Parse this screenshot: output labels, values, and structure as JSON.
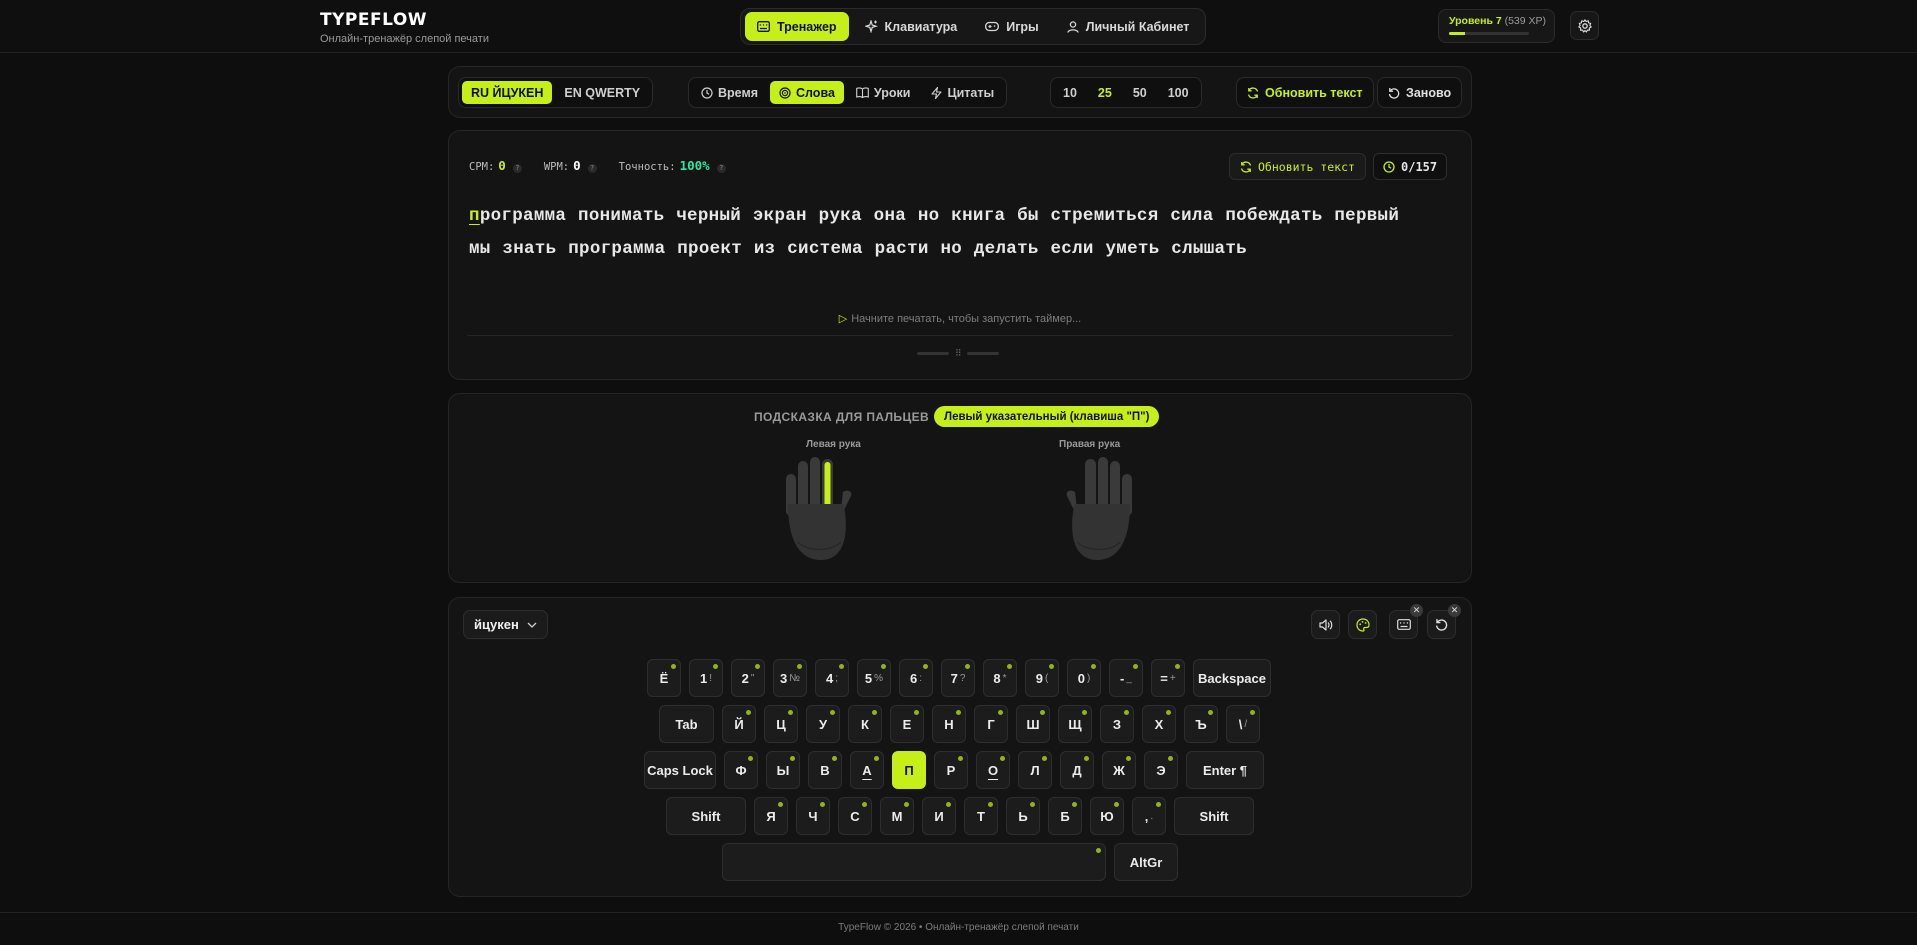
{
  "brand": {
    "title": "TYPEFLOW",
    "subtitle": "Онлайн-тренажёр слепой печати"
  },
  "nav": {
    "items": [
      {
        "label": "Тренажер",
        "icon": "keyboard-icon",
        "active": true
      },
      {
        "label": "Клавиатура",
        "icon": "sparkles-icon"
      },
      {
        "label": "Игры",
        "icon": "gamepad-icon"
      },
      {
        "label": "Личный Кабинет",
        "icon": "user-icon"
      }
    ]
  },
  "level": {
    "label": "Уровень 7",
    "xp": "(539 XP)",
    "progress": 0.2
  },
  "toolbar": {
    "layouts": [
      {
        "label": "RU ЙЦУКЕН",
        "active": true
      },
      {
        "label": "EN QWERTY"
      }
    ],
    "modes": [
      {
        "label": "Время",
        "icon": "clock-icon"
      },
      {
        "label": "Слова",
        "icon": "target-icon",
        "active": true
      },
      {
        "label": "Уроки",
        "icon": "book-icon"
      },
      {
        "label": "Цитаты",
        "icon": "quote-icon"
      }
    ],
    "counts": [
      {
        "label": "10"
      },
      {
        "label": "25",
        "active": true
      },
      {
        "label": "50"
      },
      {
        "label": "100"
      }
    ],
    "refresh_label": "Обновить текст",
    "restart_label": "Заново"
  },
  "typing": {
    "stats": [
      {
        "label": "CPM:",
        "value": "0",
        "color": "#c6ef1a"
      },
      {
        "label": "WPM:",
        "value": "0",
        "color": "#ffffff"
      },
      {
        "label": "Точность:",
        "value": "100%",
        "color": "#2ee6a0"
      }
    ],
    "help_mark": "?",
    "refresh_label": "Обновить текст",
    "counter": "0/157",
    "current_char": "п",
    "text_line1_rest": "рограмма понимать черный экран рука она но книга бы стремиться сила побеждать первый",
    "text_line2": "мы знать программа проект из система расти но делать если уметь слышать",
    "hint": "Начните печатать, чтобы запустить таймер..."
  },
  "fingers": {
    "title": "ПОДСКАЗКА ДЛЯ ПАЛЬЦЕВ",
    "badge": "Левый указательный (клавиша \"П\")",
    "left_label": "Левая рука",
    "right_label": "Правая рука"
  },
  "keyboard": {
    "layout_select": "йцукен",
    "rows": [
      [
        {
          "m": "Ё"
        },
        {
          "m": "1",
          "s": "!"
        },
        {
          "m": "2",
          "s": "\""
        },
        {
          "m": "3",
          "s": "№"
        },
        {
          "m": "4",
          "s": ";"
        },
        {
          "m": "5",
          "s": "%"
        },
        {
          "m": "6",
          "s": ":"
        },
        {
          "m": "7",
          "s": "?"
        },
        {
          "m": "8",
          "s": "*"
        },
        {
          "m": "9",
          "s": "("
        },
        {
          "m": "0",
          "s": ")"
        },
        {
          "m": "-",
          "s": "_"
        },
        {
          "m": "=",
          "s": "+"
        },
        {
          "m": "Backspace",
          "w": 78,
          "nodot": true
        }
      ],
      [
        {
          "m": "Tab",
          "w": 55,
          "nodot": true
        },
        {
          "m": "Й"
        },
        {
          "m": "Ц"
        },
        {
          "m": "У"
        },
        {
          "m": "К"
        },
        {
          "m": "Е"
        },
        {
          "m": "Н"
        },
        {
          "m": "Г"
        },
        {
          "m": "Ш"
        },
        {
          "m": "Щ"
        },
        {
          "m": "З"
        },
        {
          "m": "Х"
        },
        {
          "m": "Ъ"
        },
        {
          "m": "\\",
          "s": "/"
        }
      ],
      [
        {
          "m": "Caps Lock",
          "w": 72,
          "nodot": true
        },
        {
          "m": "Ф"
        },
        {
          "m": "Ы"
        },
        {
          "m": "В"
        },
        {
          "m": "А",
          "bump": true
        },
        {
          "m": "П",
          "hl": true
        },
        {
          "m": "Р"
        },
        {
          "m": "О",
          "bump": true
        },
        {
          "m": "Л"
        },
        {
          "m": "Д"
        },
        {
          "m": "Ж"
        },
        {
          "m": "Э"
        },
        {
          "m": "Enter ¶",
          "w": 78,
          "nodot": true
        }
      ],
      [
        {
          "m": "Shift",
          "w": 80,
          "nodot": true
        },
        {
          "m": "Я"
        },
        {
          "m": "Ч"
        },
        {
          "m": "С"
        },
        {
          "m": "М"
        },
        {
          "m": "И"
        },
        {
          "m": "Т"
        },
        {
          "m": "Ь"
        },
        {
          "m": "Б"
        },
        {
          "m": "Ю"
        },
        {
          "m": ",",
          "s": "."
        },
        {
          "m": "Shift",
          "w": 80,
          "nodot": true
        }
      ],
      [
        {
          "m": "",
          "w": 384
        },
        {
          "m": "AltGr",
          "w": 64,
          "nodot": true
        }
      ]
    ]
  },
  "footer": "TypeFlow © 2026 • Онлайн-тренажёр слепой печати"
}
